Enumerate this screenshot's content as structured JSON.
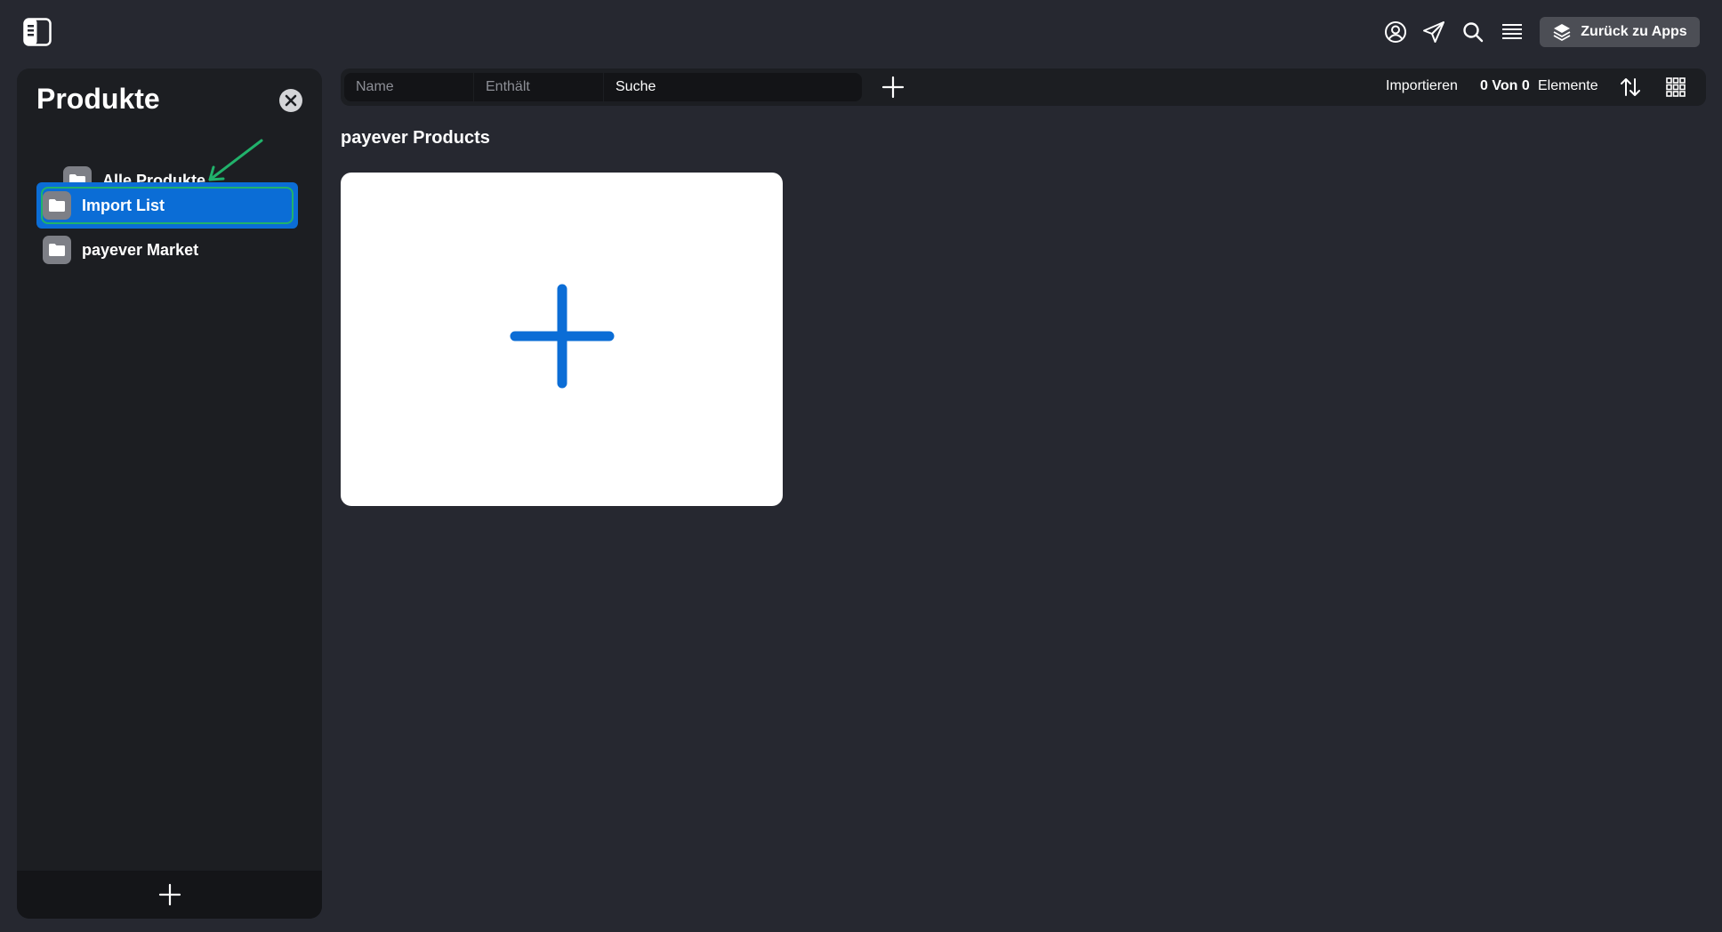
{
  "topbar": {
    "back_to_apps_label": "Zurück zu Apps"
  },
  "sidebar": {
    "title": "Produkte",
    "items": [
      {
        "label": "Alle Produkte"
      },
      {
        "label": "Import List"
      },
      {
        "label": "payever Market"
      }
    ],
    "selected": "Import List"
  },
  "toolbar": {
    "filter_field": "Name",
    "filter_condition": "Enthält",
    "search_placeholder": "Suche",
    "import_label": "Importieren",
    "count_label": "0 Von 0",
    "elements_label": "Elemente"
  },
  "main": {
    "section_title": "payever Products"
  },
  "colors": {
    "background": "#262830",
    "panel": "#1c1e22",
    "accent": "#0b6dd6",
    "annotation": "#21b26b"
  }
}
